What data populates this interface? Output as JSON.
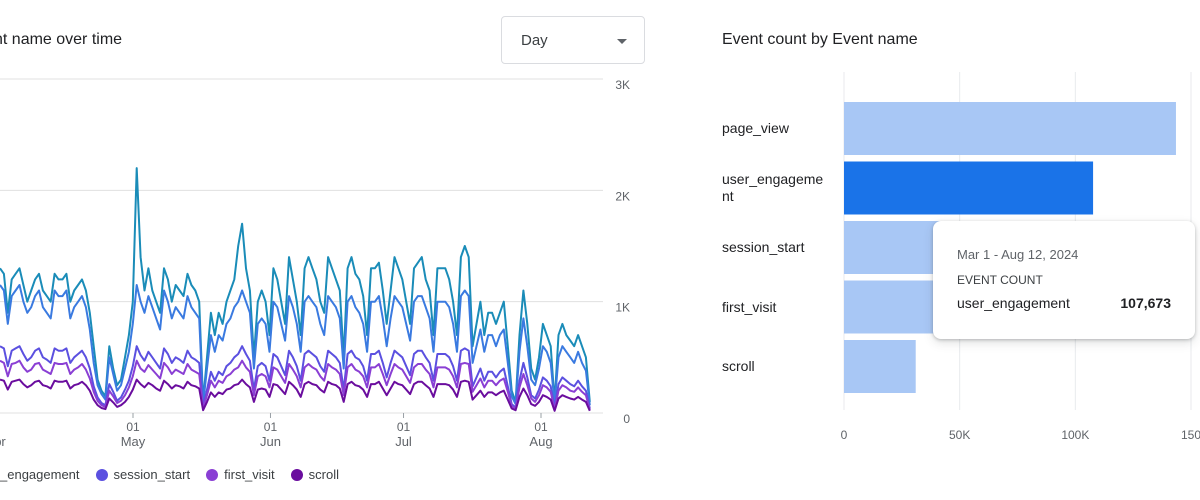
{
  "left_card": {
    "title": "nt name over time",
    "granularity": "Day"
  },
  "right_card": {
    "title": "Event count by Event name"
  },
  "tooltip": {
    "date_range": "Mar 1 - Aug 12, 2024",
    "metric_label": "EVENT COUNT",
    "event_name": "user_engagement",
    "value": "107,673"
  },
  "colors": {
    "page_view": "#1a8cb8",
    "user_engagement": "#3a7ae0",
    "session_start": "#5b50e0",
    "first_visit": "#8a3fd4",
    "scroll": "#6a0d9e",
    "bar_light": "#a8c7f5",
    "bar_highlight": "#1a73e8"
  },
  "legend": [
    {
      "label": "_engagement",
      "color": "#3a7ae0"
    },
    {
      "label": "session_start",
      "color": "#5b50e0"
    },
    {
      "label": "first_visit",
      "color": "#8a3fd4"
    },
    {
      "label": "scroll",
      "color": "#6a0d9e"
    }
  ],
  "chart_data": [
    {
      "type": "line",
      "x_ticks": [
        {
          "date": "2024-04-01",
          "day": "",
          "month": "pr"
        },
        {
          "date": "2024-05-01",
          "day": "01",
          "month": "May"
        },
        {
          "date": "2024-06-01",
          "day": "01",
          "month": "Jun"
        },
        {
          "date": "2024-07-01",
          "day": "01",
          "month": "Jul"
        },
        {
          "date": "2024-08-01",
          "day": "01",
          "month": "Aug"
        }
      ],
      "y_ticks": [
        "3K",
        "2K",
        "1K",
        "0"
      ],
      "ylim": [
        0,
        3000
      ],
      "grid": true,
      "x_start": "2024-04-01",
      "x_end": "2024-08-12",
      "series": [
        {
          "name": "page_view",
          "key": "page_view",
          "values": [
            1300,
            1250,
            900,
            1200,
            1250,
            1300,
            1150,
            1000,
            1100,
            1200,
            1250,
            1100,
            1050,
            1000,
            1250,
            1200,
            1200,
            1250,
            1000,
            1100,
            1150,
            1200,
            1100,
            900,
            600,
            300,
            200,
            150,
            600,
            400,
            250,
            300,
            500,
            700,
            1000,
            2200,
            1400,
            1100,
            1300,
            1100,
            1000,
            900,
            1300,
            1200,
            1000,
            1150,
            1100,
            1050,
            1250,
            1150,
            1100,
            1000,
            100,
            500,
            900,
            700,
            900,
            800,
            1000,
            1100,
            1200,
            1500,
            1700,
            1300,
            1100,
            500,
            1000,
            1100,
            1000,
            700,
            1300,
            1200,
            1000,
            800,
            1400,
            1200,
            1000,
            700,
            1300,
            1400,
            1300,
            1200,
            1000,
            900,
            1400,
            1300,
            1200,
            1100,
            500,
            1300,
            1400,
            1250,
            1200,
            1050,
            700,
            1300,
            1300,
            1350,
            1100,
            800,
            1100,
            1400,
            1300,
            1200,
            1000,
            800,
            1300,
            1350,
            1400,
            1200,
            1100,
            700,
            1300,
            1300,
            1300,
            1200,
            1000,
            700,
            1400,
            1500,
            1400,
            600,
            800,
            1000,
            700,
            900,
            900,
            800,
            900,
            1000,
            600,
            200,
            100,
            700,
            1100,
            800,
            400,
            300,
            500,
            800,
            700,
            600,
            100,
            700,
            800,
            700,
            650,
            600,
            700,
            600,
            500,
            100
          ]
        },
        {
          "name": "user_engagement",
          "key": "user_engagement",
          "values": [
            1150,
            1100,
            800,
            1050,
            1100,
            1150,
            1000,
            900,
            950,
            1050,
            1100,
            950,
            900,
            850,
            1100,
            1050,
            1050,
            1100,
            850,
            950,
            1000,
            1050,
            950,
            750,
            450,
            250,
            170,
            120,
            500,
            350,
            200,
            250,
            400,
            550,
            800,
            1150,
            1000,
            900,
            1050,
            950,
            850,
            750,
            1100,
            1000,
            850,
            950,
            900,
            850,
            1050,
            950,
            900,
            850,
            80,
            400,
            700,
            550,
            700,
            650,
            800,
            850,
            950,
            1000,
            1100,
            1000,
            900,
            400,
            800,
            850,
            800,
            550,
            1000,
            950,
            800,
            650,
            1050,
            950,
            800,
            550,
            1000,
            1050,
            1000,
            950,
            800,
            700,
            1050,
            1000,
            950,
            850,
            400,
            1000,
            1050,
            950,
            900,
            800,
            550,
            1000,
            1000,
            1050,
            850,
            600,
            850,
            1050,
            1000,
            950,
            800,
            650,
            1000,
            1050,
            1050,
            950,
            850,
            550,
            1000,
            1000,
            1000,
            950,
            800,
            550,
            1050,
            1100,
            1050,
            450,
            600,
            750,
            550,
            700,
            700,
            600,
            700,
            750,
            450,
            150,
            80,
            550,
            850,
            600,
            300,
            250,
            400,
            600,
            550,
            450,
            80,
            500,
            600,
            550,
            500,
            450,
            550,
            450,
            380,
            70
          ]
        },
        {
          "name": "session_start",
          "key": "session_start",
          "values": [
            600,
            580,
            420,
            560,
            580,
            600,
            530,
            470,
            500,
            560,
            580,
            500,
            480,
            450,
            580,
            560,
            560,
            580,
            450,
            500,
            530,
            560,
            500,
            400,
            240,
            140,
            90,
            70,
            260,
            190,
            110,
            140,
            210,
            290,
            420,
            600,
            520,
            470,
            550,
            500,
            450,
            400,
            580,
            530,
            450,
            500,
            480,
            450,
            560,
            500,
            480,
            450,
            50,
            210,
            370,
            290,
            370,
            340,
            420,
            450,
            500,
            530,
            600,
            530,
            470,
            210,
            420,
            450,
            420,
            290,
            530,
            500,
            420,
            340,
            560,
            500,
            420,
            290,
            530,
            560,
            530,
            500,
            420,
            370,
            560,
            530,
            500,
            450,
            210,
            530,
            560,
            500,
            480,
            420,
            290,
            530,
            530,
            560,
            450,
            320,
            450,
            560,
            530,
            500,
            420,
            340,
            530,
            560,
            560,
            500,
            450,
            290,
            530,
            530,
            530,
            500,
            420,
            290,
            560,
            580,
            560,
            240,
            320,
            400,
            290,
            370,
            370,
            320,
            370,
            400,
            240,
            80,
            50,
            290,
            450,
            320,
            160,
            130,
            210,
            320,
            290,
            240,
            40,
            260,
            320,
            290,
            260,
            240,
            290,
            240,
            200,
            40
          ]
        },
        {
          "name": "first_visit",
          "key": "first_visit",
          "values": [
            470,
            450,
            330,
            440,
            450,
            470,
            410,
            370,
            390,
            440,
            450,
            390,
            370,
            350,
            450,
            440,
            440,
            450,
            350,
            390,
            410,
            440,
            390,
            310,
            190,
            110,
            70,
            55,
            200,
            150,
            90,
            110,
            160,
            230,
            330,
            470,
            400,
            370,
            430,
            390,
            350,
            310,
            450,
            410,
            350,
            390,
            370,
            350,
            440,
            390,
            370,
            350,
            40,
            160,
            290,
            230,
            290,
            270,
            330,
            350,
            390,
            410,
            470,
            410,
            370,
            160,
            330,
            350,
            330,
            230,
            410,
            390,
            330,
            270,
            440,
            390,
            330,
            230,
            410,
            440,
            410,
            390,
            330,
            290,
            440,
            410,
            390,
            350,
            160,
            410,
            440,
            390,
            370,
            330,
            230,
            410,
            410,
            440,
            350,
            250,
            350,
            440,
            410,
            390,
            330,
            270,
            410,
            440,
            440,
            390,
            350,
            230,
            410,
            410,
            410,
            390,
            330,
            230,
            440,
            450,
            440,
            190,
            250,
            310,
            230,
            290,
            290,
            250,
            290,
            310,
            190,
            60,
            40,
            230,
            350,
            250,
            130,
            100,
            160,
            250,
            230,
            190,
            30,
            200,
            250,
            230,
            200,
            190,
            230,
            190,
            160,
            30
          ]
        },
        {
          "name": "scroll",
          "key": "scroll",
          "values": [
            300,
            290,
            210,
            280,
            290,
            300,
            260,
            230,
            250,
            280,
            290,
            250,
            240,
            220,
            290,
            280,
            280,
            290,
            220,
            250,
            260,
            280,
            250,
            200,
            120,
            70,
            45,
            35,
            130,
            95,
            55,
            70,
            100,
            145,
            210,
            300,
            260,
            230,
            270,
            250,
            220,
            200,
            290,
            260,
            220,
            250,
            240,
            220,
            280,
            250,
            240,
            220,
            25,
            100,
            185,
            145,
            185,
            170,
            210,
            220,
            250,
            260,
            300,
            260,
            230,
            100,
            210,
            220,
            210,
            145,
            260,
            250,
            210,
            170,
            280,
            250,
            210,
            145,
            260,
            280,
            260,
            250,
            210,
            185,
            280,
            260,
            250,
            220,
            100,
            260,
            280,
            250,
            240,
            210,
            145,
            260,
            260,
            280,
            220,
            160,
            220,
            280,
            260,
            250,
            210,
            170,
            260,
            280,
            280,
            250,
            220,
            145,
            260,
            260,
            260,
            250,
            210,
            145,
            280,
            290,
            280,
            120,
            160,
            200,
            145,
            185,
            185,
            160,
            185,
            200,
            120,
            40,
            25,
            145,
            220,
            160,
            80,
            65,
            100,
            160,
            145,
            120,
            20,
            130,
            160,
            145,
            130,
            120,
            145,
            120,
            100,
            20
          ]
        }
      ]
    },
    {
      "type": "bar",
      "orientation": "horizontal",
      "categories": [
        "page_view",
        "user_engagement",
        "session_start",
        "first_visit",
        "scroll"
      ],
      "category_labels": [
        "page_view",
        "user_engageme\nnt",
        "session_start",
        "first_visit",
        "scroll"
      ],
      "values": [
        143500,
        107673,
        65000,
        62000,
        31000
      ],
      "highlight_index": 1,
      "x_ticks": [
        "0",
        "50K",
        "100K",
        "150"
      ],
      "xlim": [
        0,
        150000
      ],
      "grid": true
    }
  ]
}
